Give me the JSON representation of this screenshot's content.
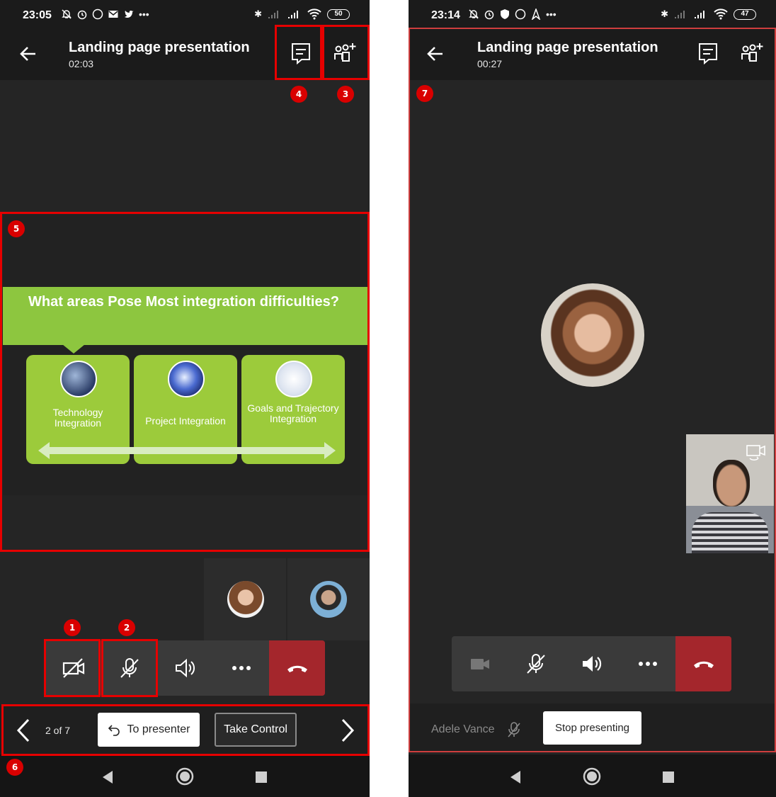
{
  "left": {
    "status": {
      "time": "23:05",
      "battery": "50"
    },
    "meeting": {
      "title": "Landing page presentation",
      "timer": "02:03"
    },
    "slide": {
      "heading": "What areas Pose Most integration difficulties?",
      "cards": [
        "Technology Integration",
        "Project Integration",
        "Goals and Trajectory Integration"
      ]
    },
    "presenter_bar": {
      "page": "2 of 7",
      "to_presenter": "To presenter",
      "take_control": "Take Control"
    },
    "badges": [
      "1",
      "2",
      "3",
      "4",
      "5",
      "6"
    ]
  },
  "right": {
    "status": {
      "time": "23:14",
      "battery": "47"
    },
    "meeting": {
      "title": "Landing page presentation",
      "timer": "00:27"
    },
    "presenter_name": "Adele Vance",
    "stop_presenting": "Stop presenting",
    "badges": [
      "7"
    ]
  },
  "colors": {
    "accent_red": "#e60000",
    "hangup": "#a4262c",
    "slide_green": "#8dc63f",
    "dark_bg": "#252525"
  },
  "icons": [
    "back-arrow-icon",
    "chat-icon",
    "add-participants-icon",
    "camera-off-icon",
    "mic-off-icon",
    "speaker-icon",
    "more-icon",
    "hang-up-icon",
    "undo-icon",
    "chevron-left-icon",
    "chevron-right-icon",
    "switch-camera-icon"
  ]
}
